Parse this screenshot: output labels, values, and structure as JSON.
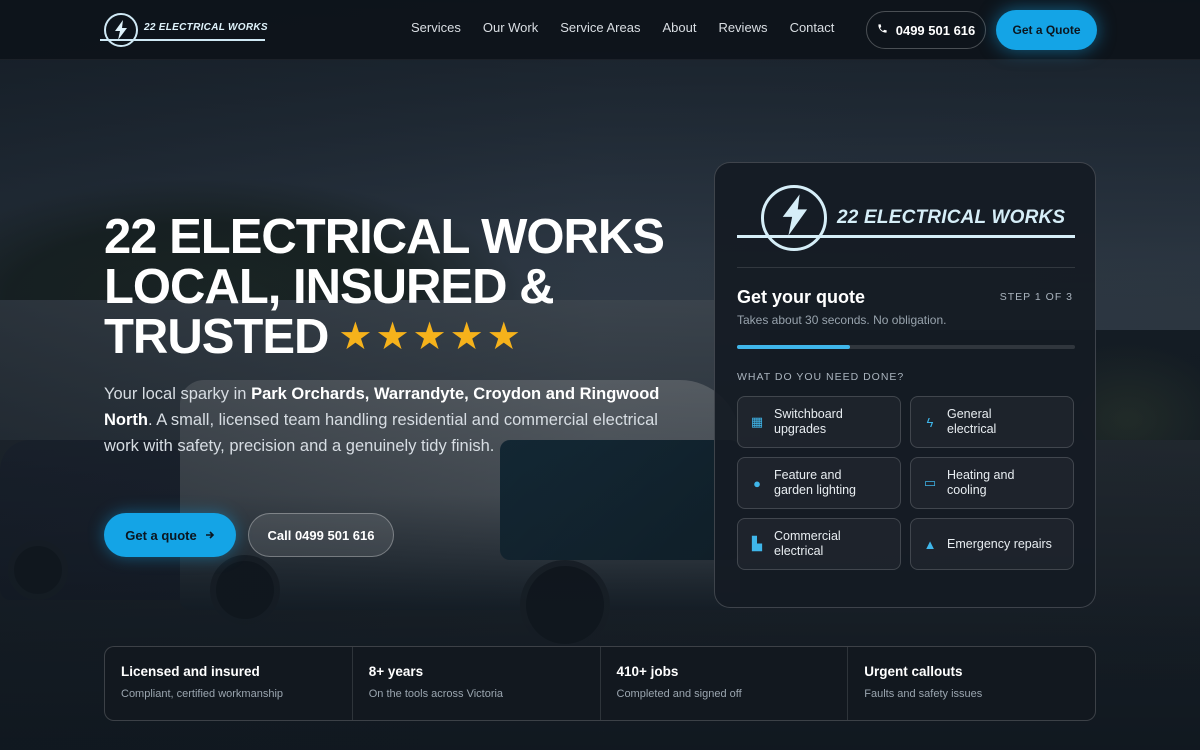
{
  "brand": {
    "name": "22 ELECTRICAL WORKS"
  },
  "nav": {
    "items": [
      "Services",
      "Our Work",
      "Service Areas",
      "About",
      "Reviews",
      "Contact"
    ],
    "phone": "0499 501 616",
    "quote_button": "Get a Quote"
  },
  "hero": {
    "title_lines": [
      "22 ELECTRICAL WORKS",
      "LOCAL, INSURED &",
      "TRUSTED"
    ],
    "rating_stars": 5,
    "subtitle_prefix": "Your local sparky in ",
    "subtitle_bold": "Park Orchards, Warrandyte, Croydon and Ringwood North",
    "subtitle_suffix": ". A small, licensed team handling residential and commercial electrical work with safety, precision and a genuinely tidy finish.",
    "primary_button": "Get a quote",
    "secondary_button": "Call 0499 501 616"
  },
  "quote_card": {
    "title": "Get your quote",
    "step": "STEP 1 OF 3",
    "note": "Takes about 30 seconds. No obligation.",
    "progress_fraction": 0.333,
    "question": "WHAT DO YOU NEED DONE?",
    "options": [
      {
        "label": "Switchboard upgrades",
        "icon": "switchboard-icon",
        "glyph": "▦"
      },
      {
        "label": "General electrical",
        "icon": "bolt-icon",
        "glyph": "ϟ"
      },
      {
        "label": "Feature and garden lighting",
        "icon": "bulb-icon",
        "glyph": "●"
      },
      {
        "label": "Heating and cooling",
        "icon": "air-conditioner-icon",
        "glyph": "▭"
      },
      {
        "label": "Commercial electrical",
        "icon": "building-icon",
        "glyph": "▙"
      },
      {
        "label": "Emergency repairs",
        "icon": "warning-icon",
        "glyph": "▲"
      }
    ]
  },
  "stats": [
    {
      "title": "Licensed and insured",
      "desc": "Compliant, certified workmanship"
    },
    {
      "title": "8+ years",
      "desc": "On the tools across Victoria"
    },
    {
      "title": "410+ jobs",
      "desc": "Completed and signed off"
    },
    {
      "title": "Urgent callouts",
      "desc": "Faults and safety issues"
    }
  ],
  "colors": {
    "accent": "#14a4e6",
    "star": "#f6b21b",
    "header_bg": "#0e141b"
  }
}
